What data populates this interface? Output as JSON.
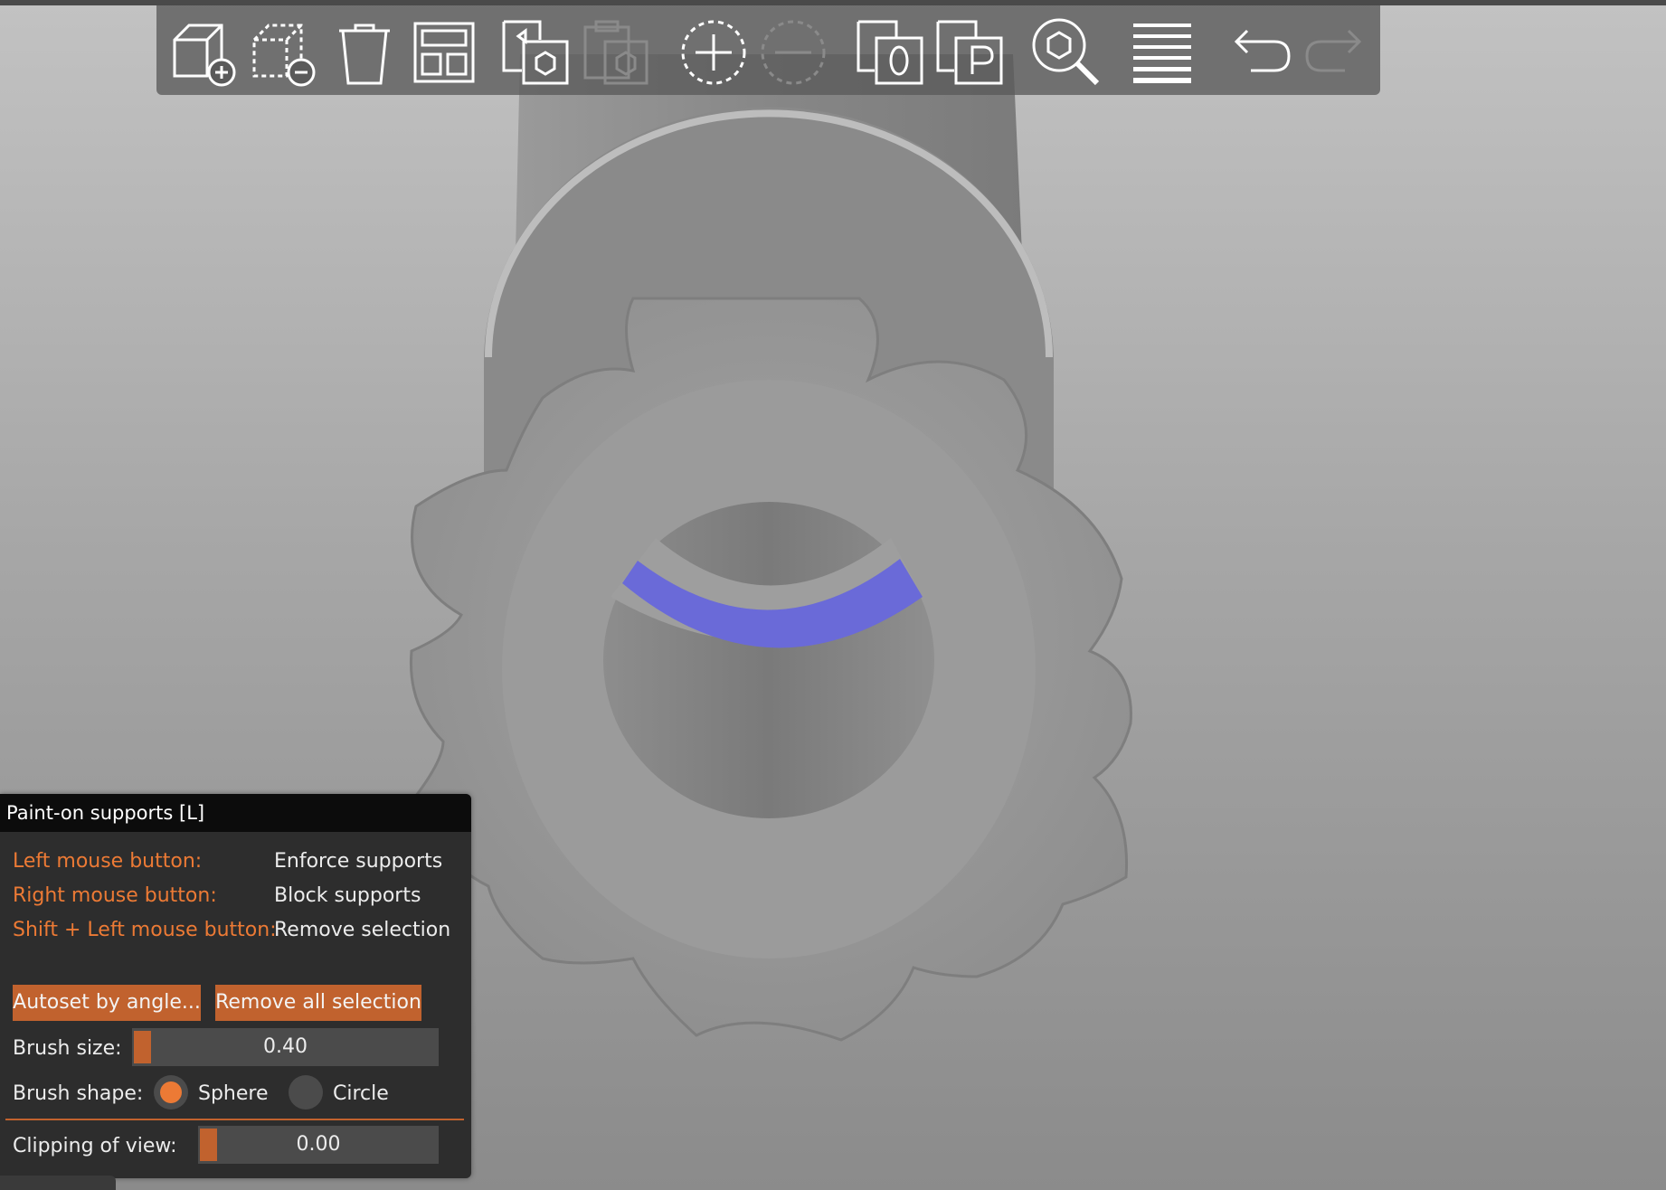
{
  "toolbar": {
    "items": [
      {
        "name": "add-object-icon",
        "enabled": true
      },
      {
        "name": "delete-object-icon",
        "enabled": true
      },
      {
        "name": "delete-all-icon",
        "enabled": true
      },
      {
        "name": "arrange-icon",
        "enabled": true
      },
      {
        "name": "copy-icon",
        "enabled": true
      },
      {
        "name": "paste-icon",
        "enabled": false
      },
      {
        "name": "add-instance-icon",
        "enabled": true
      },
      {
        "name": "remove-instance-icon",
        "enabled": false
      },
      {
        "name": "split-to-objects-icon",
        "enabled": true
      },
      {
        "name": "split-to-parts-icon",
        "enabled": true
      },
      {
        "name": "search-icon",
        "enabled": true
      },
      {
        "name": "layers-editing-icon",
        "enabled": true
      },
      {
        "name": "undo-icon",
        "enabled": true
      },
      {
        "name": "redo-icon",
        "enabled": false
      }
    ]
  },
  "colors": {
    "accent": "#ec7a35",
    "button": "#c1622e",
    "panel_bg": "#2d2d2d",
    "title_bg": "#0c0c0c",
    "paint_enforcer": "#6a6ad8"
  },
  "panel": {
    "title": "Paint-on supports [L]",
    "rows": [
      {
        "label": "Left mouse button:",
        "value": "Enforce supports"
      },
      {
        "label": "Right mouse button:",
        "value": "Block supports"
      },
      {
        "label": "Shift + Left mouse button:",
        "value": "Remove selection"
      }
    ],
    "autoset_label": "Autoset by angle...",
    "remove_all_label": "Remove all selection",
    "brush_size_label": "Brush size:",
    "brush_size_value": "0.40",
    "brush_shape_label": "Brush shape:",
    "shape_sphere": "Sphere",
    "shape_circle": "Circle",
    "selected_shape": "Sphere",
    "clipping_label": "Clipping of view:",
    "clipping_value": "0.00"
  }
}
